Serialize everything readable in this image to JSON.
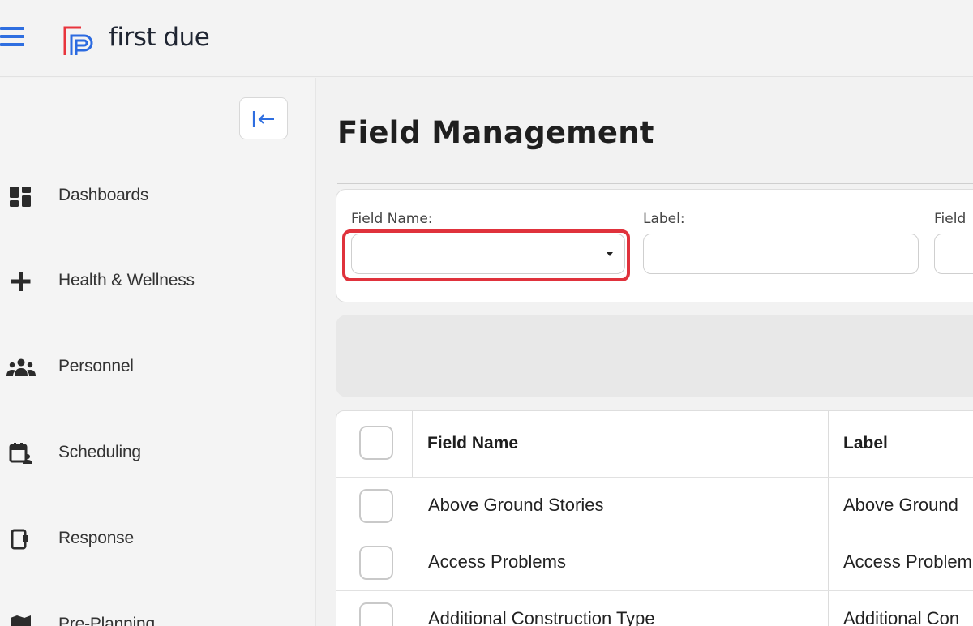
{
  "app": {
    "logo_text": "first due",
    "brand_colors": {
      "primary": "#2e6ee0",
      "logo_red": "#e8343c",
      "logo_blue": "#2b6ae0"
    }
  },
  "sidebar": {
    "collapse_icon": "collapse-left-icon",
    "items": [
      {
        "label": "Dashboards",
        "icon": "dashboard-icon"
      },
      {
        "label": "Health & Wellness",
        "icon": "plus-icon"
      },
      {
        "label": "Personnel",
        "icon": "people-icon"
      },
      {
        "label": "Scheduling",
        "icon": "calendar-person-icon"
      },
      {
        "label": "Response",
        "icon": "response-icon"
      },
      {
        "label": "Pre-Planning",
        "icon": "map-icon"
      }
    ]
  },
  "main": {
    "title": "Field Management",
    "filters": {
      "field_name_label": "Field Name:",
      "field_name_value": "",
      "label_label": "Label:",
      "label_value": "",
      "third_label": "Field",
      "third_value": ""
    },
    "table": {
      "columns": [
        "Field Name",
        "Label"
      ],
      "rows": [
        {
          "field_name": "Above Ground Stories",
          "label": "Above Ground"
        },
        {
          "field_name": "Access Problems",
          "label": "Access Problem"
        },
        {
          "field_name": "Additional Construction Type",
          "label": "Additional Con"
        }
      ]
    }
  },
  "highlight_color": "#e0323c"
}
